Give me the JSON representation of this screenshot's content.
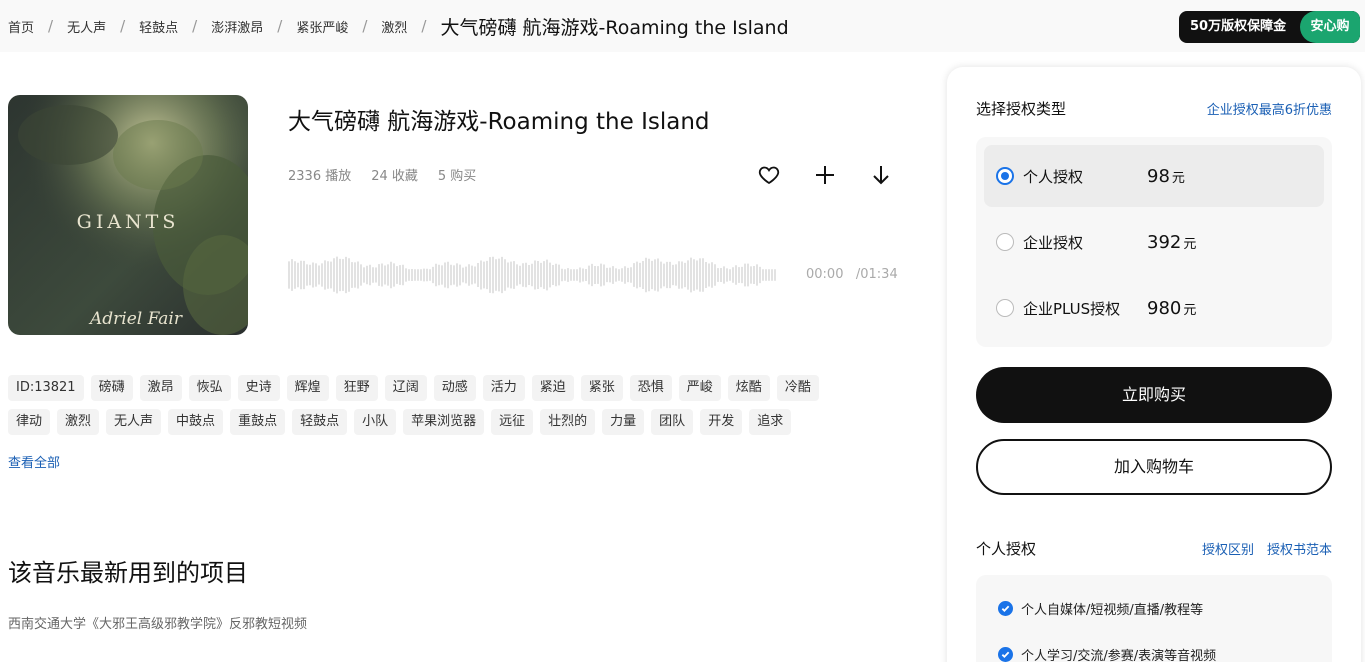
{
  "breadcrumb": {
    "items": [
      "首页",
      "无人声",
      "轻鼓点",
      "澎湃激昂",
      "紧张严峻",
      "激烈"
    ],
    "current": "大气磅礴 航海游戏-Roaming the Island"
  },
  "guarantee": {
    "text": "50万版权保障金",
    "safe": "安心购"
  },
  "cover": {
    "title": "GIANTS",
    "artist": "Adriel Fair"
  },
  "track": {
    "title": "大气磅礴 航海游戏-Roaming the Island",
    "plays": "2336 播放",
    "favorites": "24 收藏",
    "purchases": "5 购买",
    "current_time": "00:00",
    "duration": "/01:34"
  },
  "tags": {
    "row1": [
      "ID:13821",
      "磅礴",
      "激昂",
      "恢弘",
      "史诗",
      "辉煌",
      "狂野",
      "辽阔",
      "动感",
      "活力",
      "紧迫",
      "紧张",
      "恐惧",
      "严峻",
      "炫酷",
      "冷酷"
    ],
    "row2": [
      "律动",
      "激烈",
      "无人声",
      "中鼓点",
      "重鼓点",
      "轻鼓点",
      "小队",
      "苹果浏览器",
      "远征",
      "壮烈的",
      "力量",
      "团队",
      "开发",
      "追求"
    ],
    "view_all": "查看全部"
  },
  "projects": {
    "title": "该音乐最新用到的项目",
    "items": [
      "西南交通大学《大邪王高级邪教学院》反邪教短视频"
    ]
  },
  "panel": {
    "header": "选择授权类型",
    "promo": "企业授权最高6折优惠",
    "options": [
      {
        "label": "个人授权",
        "price": "98",
        "unit": "元",
        "selected": true
      },
      {
        "label": "企业授权",
        "price": "392",
        "unit": "元",
        "selected": false
      },
      {
        "label": "企业PLUS授权",
        "price": "980",
        "unit": "元",
        "selected": false
      }
    ],
    "buy": "立即购买",
    "cart": "加入购物车",
    "sub_title": "个人授权",
    "link_diff": "授权区别",
    "link_sample": "授权书范本",
    "benefits": [
      "个人自媒体/短视频/直播/教程等",
      "个人学习/交流/参赛/表演等音视频"
    ]
  },
  "colors": {
    "accent": "#1a73e8",
    "link": "#1a5fb4",
    "safe_green": "#1ba56f",
    "primary_btn": "#111111"
  }
}
